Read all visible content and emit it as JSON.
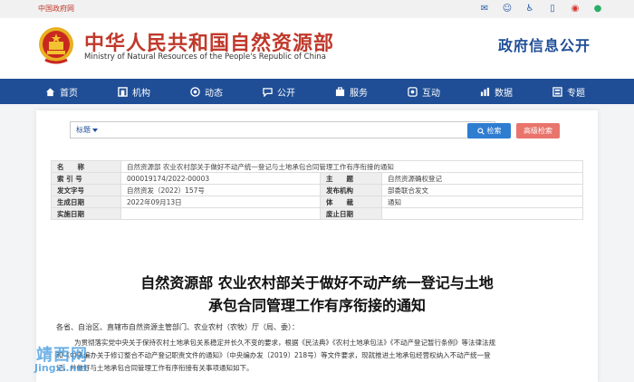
{
  "topbar": {
    "gov_label": "中国政府网",
    "icons": [
      "mail-icon",
      "user-icon",
      "accessibility-icon",
      "mobile-icon",
      "weibo-icon",
      "wechat-icon"
    ]
  },
  "header": {
    "ministry_cn": "中华人民共和国自然资源部",
    "ministry_en": "Ministry of Natural Resources of the People's Republic of China",
    "section_title": "政府信息公开"
  },
  "nav": {
    "items": [
      {
        "label": "首页",
        "icon": "home-icon"
      },
      {
        "label": "机构",
        "icon": "org-icon"
      },
      {
        "label": "动态",
        "icon": "news-icon"
      },
      {
        "label": "公开",
        "icon": "chat-icon"
      },
      {
        "label": "服务",
        "icon": "service-icon"
      },
      {
        "label": "互动",
        "icon": "interact-icon"
      },
      {
        "label": "数据",
        "icon": "data-icon"
      },
      {
        "label": "专题",
        "icon": "topic-icon"
      }
    ]
  },
  "search": {
    "field_select": "标题",
    "button_label": "检索",
    "advanced_label": "高级检索"
  },
  "meta": {
    "name_label": "名　　称",
    "name_value": "自然资源部 农业农村部关于做好不动产统一登记与土地承包合同管理工作有序衔接的通知",
    "index_label": "索 引 号",
    "index_value": "000019174/2022-00003",
    "topic_label": "主　　题",
    "topic_value": "自然资源确权登记",
    "docno_label": "发文字号",
    "docno_value": "自然资发（2022）157号",
    "issuer_label": "发布机构",
    "issuer_value": "部委联合发文",
    "date_label": "生成日期",
    "date_value": "2022年09月13日",
    "genre_label": "体　　裁",
    "genre_value": "通知",
    "effective_label": "实施日期",
    "effective_value": "",
    "abolish_label": "废止日期",
    "abolish_value": ""
  },
  "doc": {
    "title_line1": "自然资源部 农业农村部关于做好不动产统一登记与土地",
    "title_line2": "承包合同管理工作有序衔接的通知",
    "address": "各省、自治区、直辖市自然资源主管部门、农业农村（农牧）厅（局、委）：",
    "para1": "为贯彻落实党中央关于保持农村土地承包关系稳定并长久不变的要求，根据《民法典》《农村土地承包法》《不动产登记暂行条例》等法律法规",
    "para2": "和《中央编办关于修订整合不动产登记职责文件的通知》（中央编办发〔2019〕218号）等文件要求，现就推进土地承包经营权纳入不动产统一登",
    "para3": "记，并做好与土地承包合同管理工作有序衔接有关事项通知如下。"
  },
  "watermark": {
    "cn": "靖西网",
    "en": "Jingxi.net"
  }
}
